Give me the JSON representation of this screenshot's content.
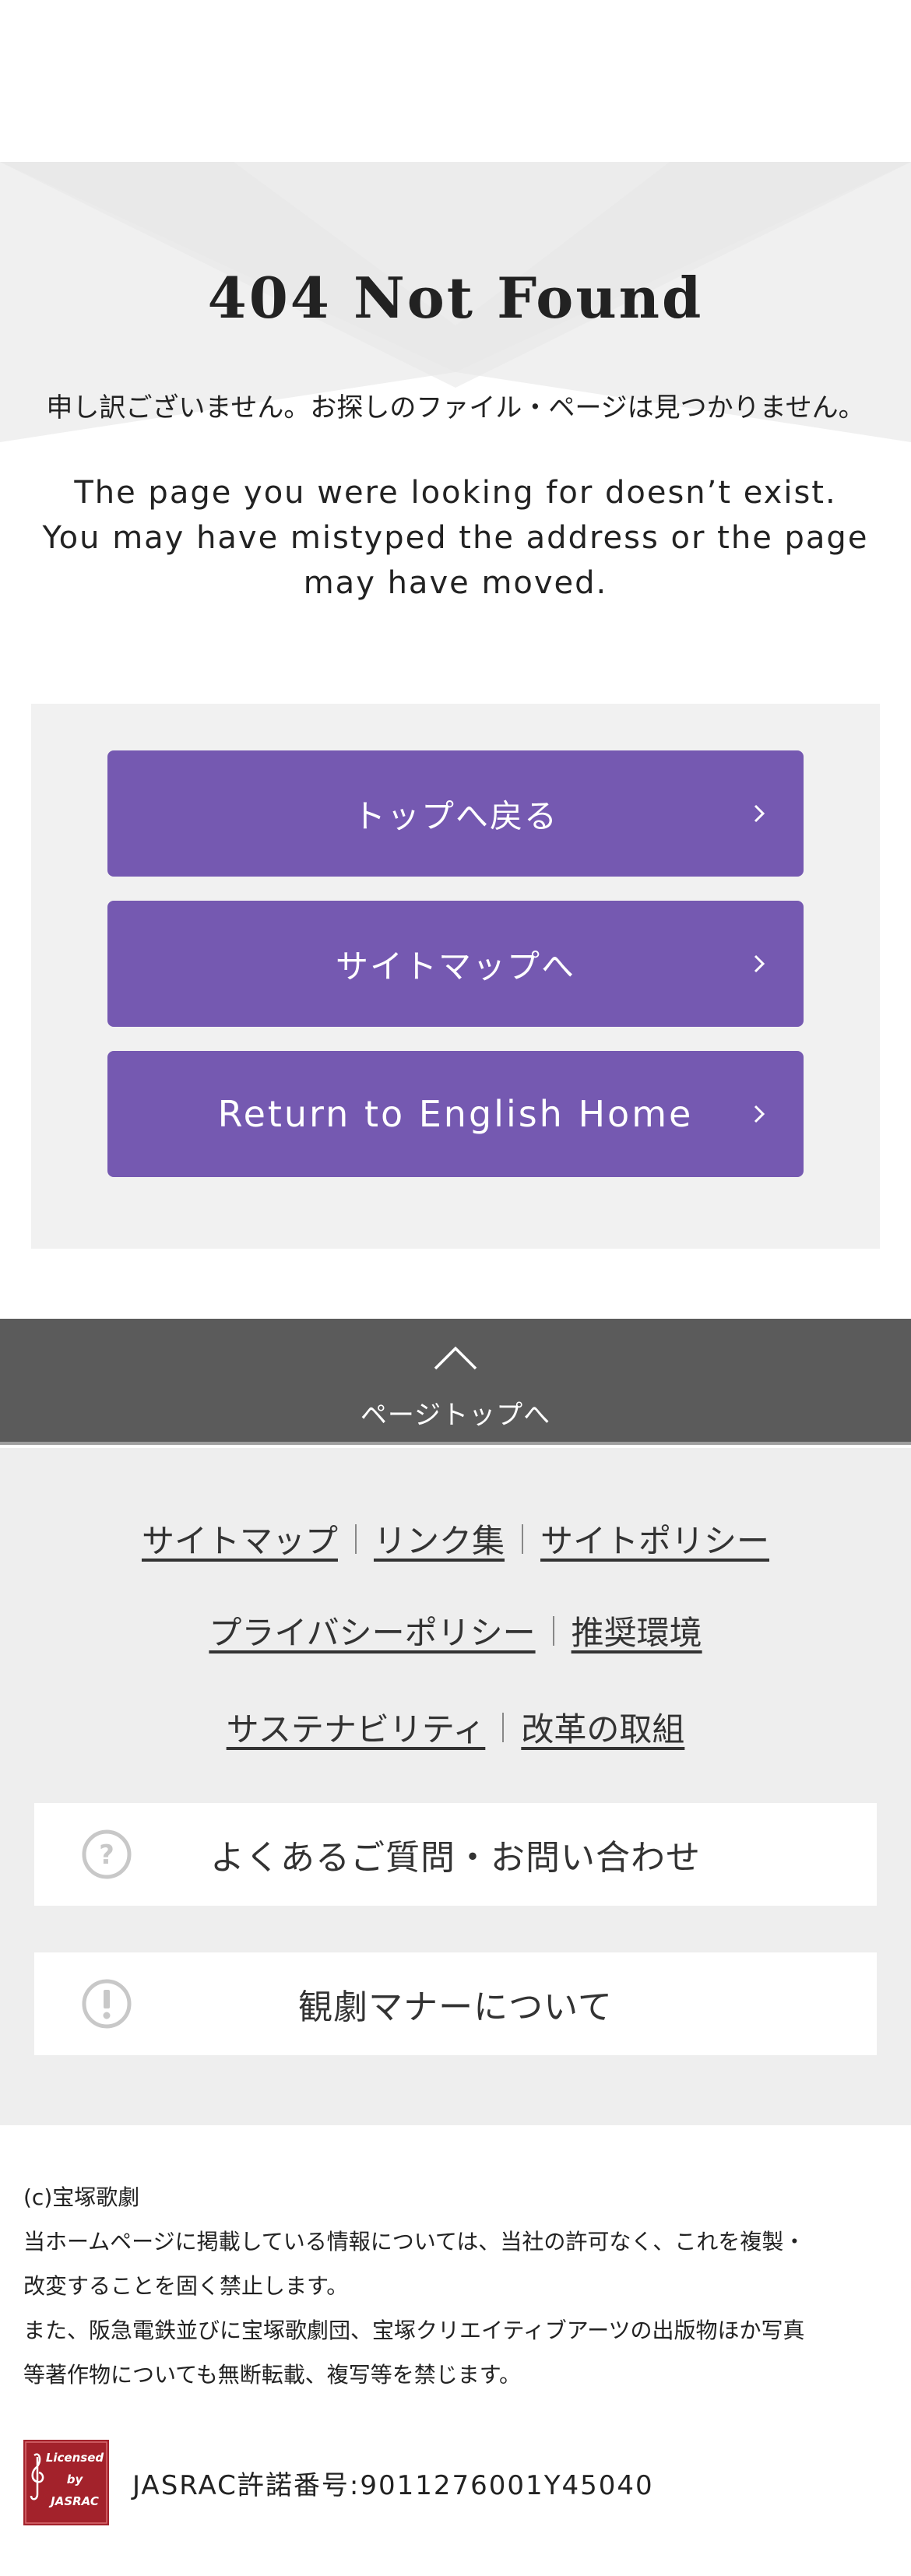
{
  "hero": {
    "title": "404 Not Found",
    "message_jp": "申し訳ございません。お探しのファイル・ページは見つかりません。"
  },
  "message_en": {
    "line1": "The page you were looking for doesn’t exist.",
    "line2": "You may have mistyped the address or the page",
    "line3": "may have moved."
  },
  "buttons": [
    {
      "label": "トップへ戻る",
      "icon": "chevron-right-icon"
    },
    {
      "label": "サイトマップへ",
      "icon": "chevron-right-icon"
    },
    {
      "label": "Return to English Home",
      "icon": "chevron-right-icon"
    }
  ],
  "page_top": {
    "label": "ページトップへ",
    "icon": "chevron-up-icon"
  },
  "footer_links": {
    "row1": [
      "サイトマップ",
      "リンク集",
      "サイトポリシー"
    ],
    "row2": [
      "プライバシーポリシー",
      "推奨環境"
    ],
    "row3": [
      "サステナビリティ",
      "改革の取組"
    ]
  },
  "info_boxes": [
    {
      "label": "よくあるご質問・お問い合わせ",
      "icon": "question-circle-icon"
    },
    {
      "label": "観劇マナーについて",
      "icon": "exclamation-circle-icon"
    }
  ],
  "copyright": {
    "line1": "(c)宝塚歌劇",
    "line2": "当ホームページに掲載している情報については、当社の許可なく、これを複製・",
    "line3": "改変することを固く禁止します。",
    "line4": "また、阪急電鉄並びに宝塚歌劇団、宝塚クリエイティブアーツの出版物ほか写真",
    "line5": "等著作物についても無断転載、複写等を禁じます。"
  },
  "jasrac": {
    "logo_text": [
      "Licensed",
      "by",
      "JASRAC"
    ],
    "number": "JASRAC許諾番号:9011276001Y45040"
  },
  "colors": {
    "accent": "#7559b1",
    "pagetop_bg": "#5b5b5b",
    "footer_bg": "#eeeeee",
    "panel_bg": "#f1f1f1",
    "logo_red": "#a3222b"
  }
}
